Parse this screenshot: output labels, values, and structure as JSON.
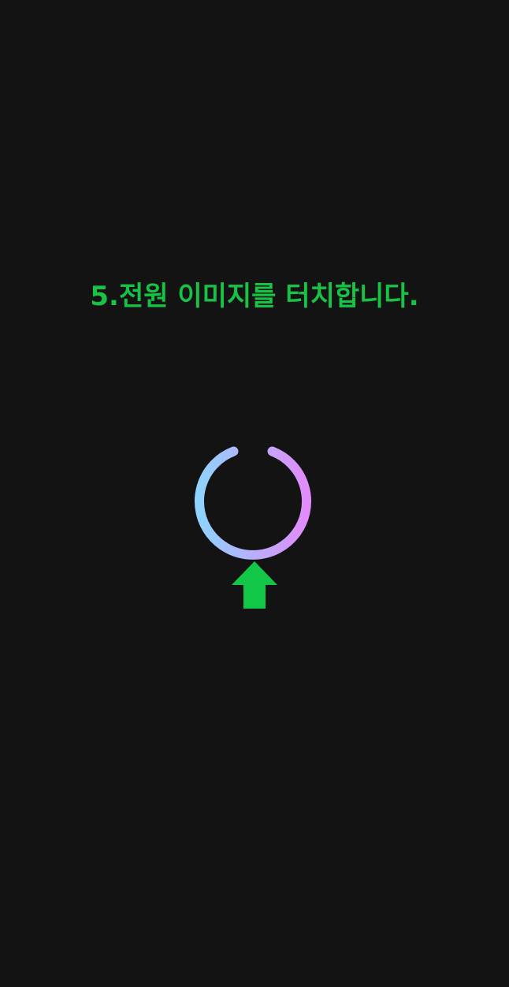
{
  "screen": {
    "instruction_text": "5.전원 이미지를 터치합니다.",
    "power_button": {
      "icon": "power-icon"
    },
    "pointer": {
      "icon": "arrow-up-icon"
    }
  },
  "colors": {
    "background": "#131313",
    "instruction_text": "#17c245",
    "power_gradient_start": "#8fd2ff",
    "power_gradient_end": "#e18cf9",
    "arrow": "#12c648"
  }
}
